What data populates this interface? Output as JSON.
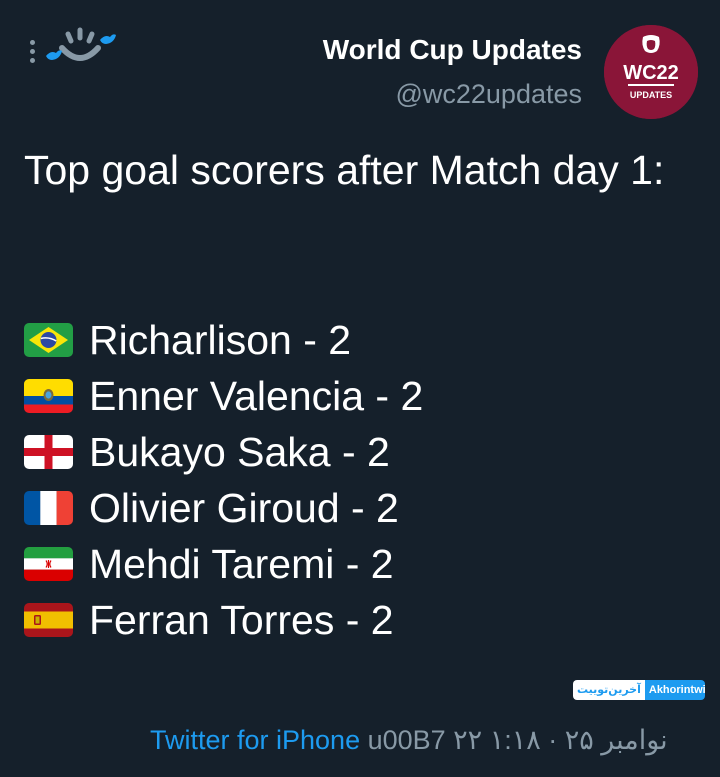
{
  "author": {
    "name": "World Cup Updates",
    "handle": "@wc22updates",
    "avatar_text": "WC22",
    "avatar_subtext": "UPDATES",
    "avatar_color": "#8a1538"
  },
  "tweet": {
    "text": "Top goal scorers after Match day 1:",
    "scorers": [
      {
        "flag": "brazil-flag",
        "text": "Richarlison - 2"
      },
      {
        "flag": "ecuador-flag",
        "text": "Enner Valencia - 2"
      },
      {
        "flag": "england-flag",
        "text": "Bukayo Saka - 2"
      },
      {
        "flag": "france-flag",
        "text": "Olivier Giroud - 2"
      },
      {
        "flag": "iran-flag",
        "text": "Mehdi Taremi - 2"
      },
      {
        "flag": "spain-flag",
        "text": "Ferran Torres - 2"
      }
    ]
  },
  "watermark": {
    "arabic": "آخرین‌توییت",
    "latin": "Akhorintwit"
  },
  "footer": {
    "source": "Twitter for iPhone",
    "meta": " u00B7 ۲۲ نوامبر ۲۵ · ۱:۱۸"
  },
  "colors": {
    "background": "#15202b",
    "accent": "#1d9bf0",
    "secondary_text": "#8899a6"
  }
}
